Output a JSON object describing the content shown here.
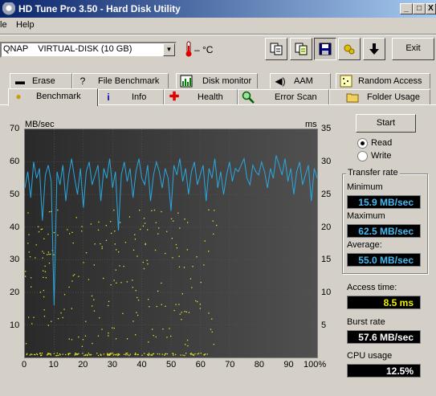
{
  "window": {
    "title": "HD Tune Pro 3.50 - Hard Disk Utility",
    "controls": [
      "_",
      "□",
      "X"
    ]
  },
  "menu": {
    "items": [
      "File",
      "Help"
    ],
    "visible_items": [
      "le",
      "Help"
    ]
  },
  "toolbar": {
    "drive": "QNAP    VIRTUAL-DISK (10 GB)",
    "temperature": "– °C",
    "buttons": [
      {
        "icon": "copy-icon"
      },
      {
        "icon": "copy-all-icon"
      },
      {
        "icon": "save-icon"
      },
      {
        "icon": "options-icon"
      },
      {
        "icon": "download-icon"
      }
    ],
    "exit_label": "Exit"
  },
  "tabs_row1": [
    {
      "label": "Erase",
      "icon": "erase-icon"
    },
    {
      "label": "File Benchmark",
      "icon": "file-benchmark-icon"
    },
    {
      "label": "Disk monitor",
      "icon": "disk-monitor-icon"
    },
    {
      "label": "AAM",
      "icon": "speaker-icon"
    },
    {
      "label": "Random Access",
      "icon": "random-access-icon"
    }
  ],
  "tabs_row2": [
    {
      "label": "Benchmark",
      "icon": "bulb-icon",
      "active": true
    },
    {
      "label": "Info",
      "icon": "info-icon"
    },
    {
      "label": "Health",
      "icon": "health-cross-icon"
    },
    {
      "label": "Error Scan",
      "icon": "magnifier-icon"
    },
    {
      "label": "Folder Usage",
      "icon": "folder-icon"
    }
  ],
  "controls": {
    "start_label": "Start",
    "mode_read": "Read",
    "mode_write": "Write",
    "selected_mode": "Read"
  },
  "stats": {
    "group_title": "Transfer rate",
    "minimum_label": "Minimum",
    "minimum_value": "15.9 MB/sec",
    "maximum_label": "Maximum",
    "maximum_value": "62.5 MB/sec",
    "average_label": "Average:",
    "average_value": "55.0 MB/sec",
    "access_label": "Access time:",
    "access_value": "8.5 ms",
    "burst_label": "Burst rate",
    "burst_value": "57.6 MB/sec",
    "cpu_label": "CPU usage",
    "cpu_value": "12.5%"
  },
  "colors": {
    "transfer_line": "#2aa8e0",
    "access_dots": "#e8e82a",
    "chart_bg": "#000000",
    "stat_text_blue": "#48b8f0",
    "stat_text_yellow": "#f0f000"
  },
  "chart_data": {
    "type": "line",
    "left_unit": "MB/sec",
    "right_unit": "ms",
    "y_left_ticks": [
      "70",
      "60",
      "50",
      "40",
      "30",
      "20",
      "10"
    ],
    "y_right_ticks": [
      "35",
      "30",
      "25",
      "20",
      "15",
      "10",
      "5"
    ],
    "x_ticks": [
      "0",
      "10",
      "20",
      "30",
      "40",
      "50",
      "60",
      "70",
      "80",
      "90",
      "100%"
    ],
    "xlim": [
      0,
      100
    ],
    "ylim_left": [
      0,
      70
    ],
    "ylim_right": [
      0,
      35
    ],
    "grid": true,
    "series": [
      {
        "x": [
          0,
          1,
          2,
          3,
          4,
          5,
          6,
          7,
          8,
          9,
          10,
          11,
          12,
          13,
          14,
          15,
          16,
          17,
          18,
          19,
          20,
          21,
          22,
          23,
          24,
          25,
          26,
          27,
          28,
          29,
          30,
          31,
          32,
          33,
          34,
          35,
          36,
          37,
          38,
          39,
          40,
          41,
          42,
          43,
          44,
          45,
          46,
          47,
          48,
          49,
          50,
          51,
          52,
          53,
          54,
          55,
          56,
          57,
          58,
          59,
          60,
          61,
          62,
          63,
          64,
          65,
          66,
          67,
          68,
          69,
          70,
          71,
          72,
          73,
          74,
          75,
          76,
          77,
          78,
          79,
          80,
          81,
          82,
          83,
          84,
          85,
          86,
          87,
          88,
          89,
          90,
          91,
          92,
          93,
          94,
          95,
          96,
          97,
          98,
          99,
          100
        ],
        "values": [
          52,
          57,
          49,
          60,
          55,
          58,
          42,
          56,
          59,
          54,
          16,
          57,
          53,
          59,
          48,
          56,
          61,
          55,
          50,
          58,
          46,
          57,
          60,
          53,
          56,
          59,
          48,
          58,
          55,
          61,
          52,
          57,
          39,
          56,
          60,
          54,
          58,
          49,
          57,
          61,
          55,
          53,
          59,
          48,
          56,
          60,
          57,
          52,
          58,
          55,
          45,
          59,
          56,
          61,
          54,
          58,
          50,
          57,
          60,
          53,
          56,
          59,
          48,
          58,
          55,
          61,
          52,
          57,
          50,
          56,
          60,
          54,
          58,
          57,
          59,
          61,
          55,
          53,
          59,
          57,
          56,
          60,
          57,
          52,
          58,
          55,
          62,
          59,
          56,
          61,
          54,
          58,
          50,
          57,
          60,
          53,
          56,
          59,
          48,
          58,
          55
        ]
      }
    ]
  }
}
